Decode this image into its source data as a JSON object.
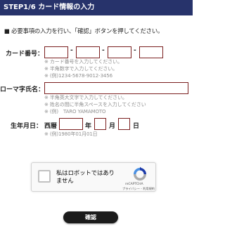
{
  "header": {
    "title": "STEP1/6 カード情報の入力"
  },
  "instruction": "■ 必要事項の入力を行い、「確認」ボタンを押してください。",
  "card_number": {
    "label": "カード番号：",
    "separator": "-",
    "notes": [
      "※ カード番号を入力してください。",
      "※ 半角数字で入力してください。",
      "※ (例)1234-5678-9012-3456"
    ]
  },
  "romaji_name": {
    "label": "ローマ字氏名：",
    "notes": [
      "※ 半角英大文字で入力してください。",
      "※ 姓名の間に半角スペースを入力してください",
      "※ (例)　TARO YAMAMOTO"
    ]
  },
  "birthdate": {
    "label": "生年月日：",
    "era": "西暦",
    "year_unit": "年",
    "month_unit": "月",
    "day_unit": "日",
    "note": "※ (例)1980年01月01日"
  },
  "recaptcha": {
    "checkbox_label_line1": "私はロボットではあり",
    "checkbox_label_line2": "ません",
    "brand": "reCAPTCHA",
    "links": "プライバシー - 利用規約",
    "logo_colors": {
      "blue": "#1c3aa9",
      "light_blue": "#4a90e2",
      "grey": "#ababab"
    }
  },
  "submit": {
    "label": "確認"
  },
  "colors": {
    "header_bg": "#27336b",
    "input_border": "#7a1f1f",
    "button_bg": "#1b1b1b",
    "note_text": "#8f8f8f"
  }
}
